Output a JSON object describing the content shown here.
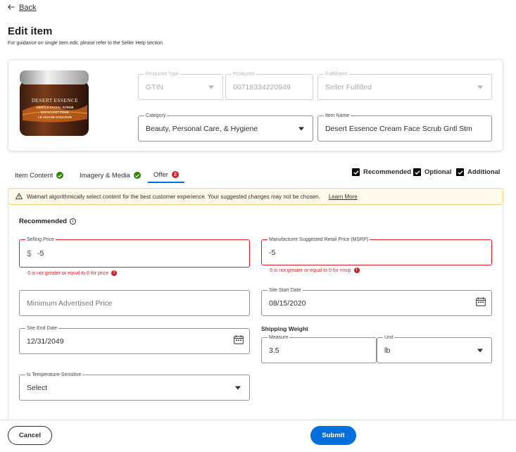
{
  "nav": {
    "back_label": "Back"
  },
  "page": {
    "title": "Edit item",
    "guidance": "For guidance on single item edit, please refer to the Seller Help section."
  },
  "product": {
    "jar_brand": "DESERT ESSENCE",
    "jar_line1": "GENTLE FACIAL SCRUB",
    "jar_line2": "EXFOLIANT POUR",
    "jar_line3": "LE VISAGE DOUCEUR",
    "productid_type": {
      "label": "ProductId Type",
      "value": "GTIN"
    },
    "productid": {
      "label": "ProductId",
      "value": "00718334220949"
    },
    "fulfillment": {
      "label": "Fulfillment",
      "value": "Seller Fulfilled"
    },
    "category": {
      "label": "Category",
      "value": "Beauty, Personal Care, & Hygiene"
    },
    "item_name": {
      "label": "Item Name",
      "value": "Desert Essence Cream Face Scrub Gntl Stm"
    }
  },
  "tabs": [
    {
      "label": "Item Content"
    },
    {
      "label": "Imagery & Media"
    },
    {
      "label": "Offer",
      "badge": "2"
    }
  ],
  "filters": [
    {
      "label": "Recommended",
      "checked": true
    },
    {
      "label": "Optional",
      "checked": true
    },
    {
      "label": "Additional",
      "checked": true
    }
  ],
  "alert": {
    "message": "Walmart algorithmically select content for the best customer experience. Your suggested changes may not be chosen.",
    "link": "Learn More"
  },
  "offer": {
    "section_title": "Recommended",
    "selling_price": {
      "label": "Selling Price",
      "currency": "$",
      "value": "-5",
      "error": "-5 is not greater or equal to 0 for price"
    },
    "msrp": {
      "label": "Manufacturer Suggested Retail Price (MSRP)",
      "value": "-5",
      "error": "-5 is not greater or equal to 0 for msrp"
    },
    "map_price": {
      "placeholder": "Minimum Advertised Price"
    },
    "site_start": {
      "label": "Site Start Date",
      "value": "08/15/2020"
    },
    "site_end": {
      "label": "Site End Date",
      "value": "12/31/2049"
    },
    "shipping_weight": {
      "title": "Shipping Weight",
      "measure": {
        "label": "Measure",
        "value": "3.5"
      },
      "unit": {
        "label": "Unit",
        "value": "lb"
      }
    },
    "temperature": {
      "label": "Is Temperature-Sensitive",
      "value": "Select"
    }
  },
  "footer": {
    "cancel_label": "Cancel",
    "submit_label": "Submit"
  },
  "colors": {
    "accent": "#0071dc",
    "error": "#de1c24",
    "success": "#2a8703",
    "alert_bg": "#fff9e9"
  }
}
